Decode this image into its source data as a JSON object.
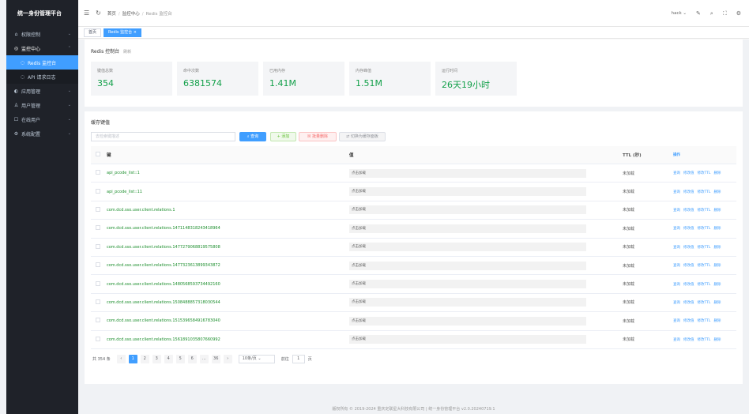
{
  "sidebar": {
    "logo": "统一身份管理平台",
    "items": [
      {
        "label": "权限控制",
        "icon": "⌂",
        "arrow": "⌄"
      },
      {
        "label": "监控中心",
        "icon": "◎",
        "arrow": "⌃"
      },
      {
        "label": "Redis 监控台",
        "icon": "◌"
      },
      {
        "label": "API 请求日志",
        "icon": "◌"
      },
      {
        "label": "应用管理",
        "icon": "◐",
        "arrow": "⌄"
      },
      {
        "label": "用户管理",
        "icon": "♙",
        "arrow": "⌄"
      },
      {
        "label": "在线用户",
        "icon": "☐",
        "arrow": "⌄"
      },
      {
        "label": "系统配置",
        "icon": "⚙",
        "arrow": "⌄"
      }
    ]
  },
  "navbar": {
    "breadcrumb": [
      "首页",
      "监控中心",
      "Redis 监控台"
    ],
    "user": "hack ⌄"
  },
  "tags": [
    "首页",
    "Redis 监控台 ×"
  ],
  "overview": {
    "title": "Redis 控制台",
    "refresh": "刷新",
    "stats": [
      {
        "label": "键值总数",
        "value": "354"
      },
      {
        "label": "命中次数",
        "value": "6381574"
      },
      {
        "label": "已用内存",
        "value": "1.41M"
      },
      {
        "label": "内存峰值",
        "value": "1.51M"
      },
      {
        "label": "运行时间",
        "value": "26天19小时"
      }
    ]
  },
  "keys": {
    "title": "缓存键值",
    "search_placeholder": "去检索键描述",
    "btn_query": "⌕ 查询",
    "btn_add": "+ 添加",
    "btn_delete": "☒ 批量删除",
    "btn_switch": "⇄ 切换为缓存面板",
    "columns": [
      "键",
      "值",
      "TTL (秒)",
      "操作"
    ],
    "rows": [
      {
        "key": "api_pcode_list::1",
        "value": "点击加载",
        "ttl": "未加载"
      },
      {
        "key": "api_pcode_list::11",
        "value": "点击加载",
        "ttl": "未加载"
      },
      {
        "key": "com.dcd.sso.user.client.relations.1",
        "value": "点击加载",
        "ttl": "未加载"
      },
      {
        "key": "com.dcd.sso.user.client.relations.1471148318243418964",
        "value": "点击加载",
        "ttl": "未加载"
      },
      {
        "key": "com.dcd.sso.user.client.relations.1477279068819575808",
        "value": "点击加载",
        "ttl": "未加载"
      },
      {
        "key": "com.dcd.sso.user.client.relations.1477323613899343872",
        "value": "点击加载",
        "ttl": "未加载"
      },
      {
        "key": "com.dcd.sso.user.client.relations.1480568593734492160",
        "value": "点击加载",
        "ttl": "未加载"
      },
      {
        "key": "com.dcd.sso.user.client.relations.1508488857318030544",
        "value": "点击加载",
        "ttl": "未加载"
      },
      {
        "key": "com.dcd.sso.user.client.relations.1515396584916783040",
        "value": "点击加载",
        "ttl": "未加载"
      },
      {
        "key": "com.dcd.sso.user.client.relations.1561891035807660992",
        "value": "点击加载",
        "ttl": "未加载"
      }
    ],
    "ops": [
      "查询",
      "修改值",
      "修改TTL",
      "删除"
    ]
  },
  "pager": {
    "total": "共 354 条",
    "prev": "‹",
    "pages": [
      "1",
      "2",
      "3",
      "4",
      "5",
      "6",
      "…",
      "36"
    ],
    "next": "›",
    "size": "10条/页 ⌄",
    "goto": "前往",
    "goto_value": "1",
    "unit": "页"
  },
  "footer": "版权所有 © 2019-2024 重庆定联星大科技有限公司 | 统一身份管理平台 v2.0.20240719.1"
}
